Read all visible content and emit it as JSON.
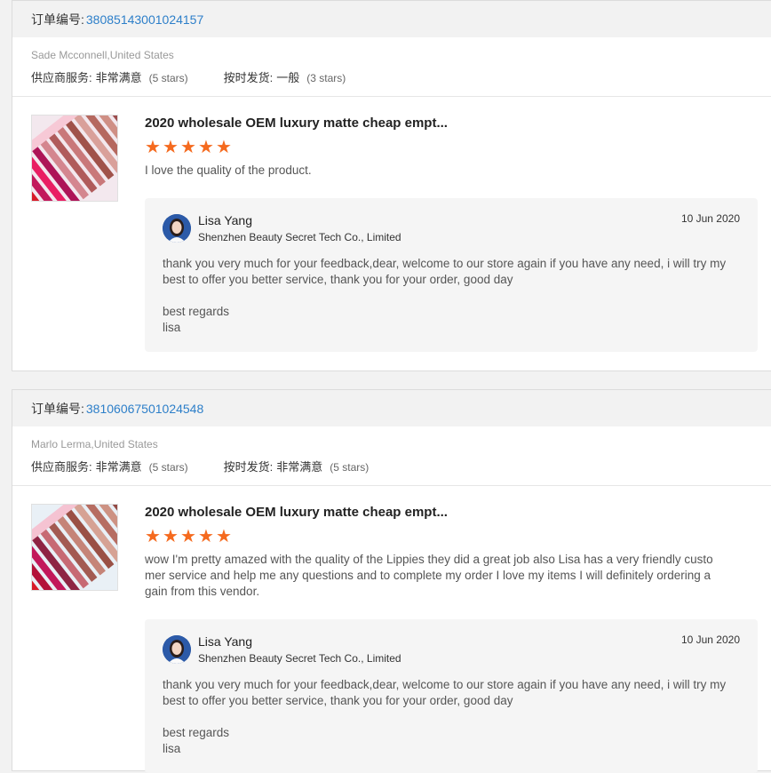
{
  "orders": [
    {
      "order_label": "订单编号:",
      "order_number": "38085143001024157",
      "buyer": "Sade Mcconnell,United States",
      "supplier_service": {
        "label": "供应商服务:",
        "value": "非常满意",
        "stars": "(5 stars)"
      },
      "on_time_delivery": {
        "label": "按时发货:",
        "value": "一般",
        "stars": "(3 stars)"
      },
      "product_title": "2020 wholesale OEM luxury matte cheap empt...",
      "rating_stars": 5,
      "review_text": "I love the quality of the product.",
      "reply": {
        "seller_name": "Lisa Yang",
        "company": "Shenzhen Beauty Secret Tech Co., Limited",
        "date": "10 Jun 2020",
        "text": "thank you very much for your feedback,dear, welcome to our store again if you have any need, i will try my best to offer you better service, thank you for your order, good day",
        "sign_1": "best regards",
        "sign_2": "lisa"
      }
    },
    {
      "order_label": "订单编号:",
      "order_number": "38106067501024548",
      "buyer": "Marlo Lerma,United States",
      "supplier_service": {
        "label": "供应商服务:",
        "value": "非常满意",
        "stars": "(5 stars)"
      },
      "on_time_delivery": {
        "label": "按时发货:",
        "value": "非常满意",
        "stars": "(5 stars)"
      },
      "product_title": "2020 wholesale OEM luxury matte cheap empt...",
      "rating_stars": 5,
      "review_text": "wow I'm pretty amazed with the quality of the Lippies they did a great job also Lisa has a very friendly custo mer service and help me any questions and to complete my order I love my items I will definitely ordering a gain from this vendor.",
      "reply": {
        "seller_name": "Lisa Yang",
        "company": "Shenzhen Beauty Secret Tech Co., Limited",
        "date": "10 Jun 2020",
        "text": "thank you very much for your feedback,dear, welcome to our store again if you have any need, i will try my best to offer you better service, thank you for your order, good day",
        "sign_1": "best regards",
        "sign_2": "lisa"
      }
    }
  ],
  "colors": {
    "accent_link": "#2d7fc9",
    "star": "#f56a1e"
  },
  "icons": {
    "star": "star-icon",
    "avatar": "seller-avatar"
  }
}
